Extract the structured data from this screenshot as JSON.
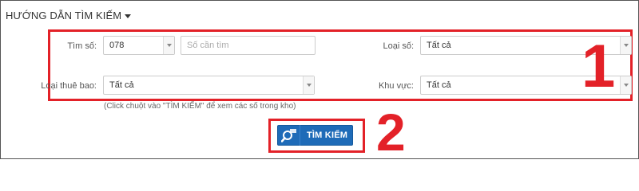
{
  "guide": {
    "title": "HƯỚNG DẪN TÌM KIẾM"
  },
  "form": {
    "find_number": {
      "label": "Tìm số:",
      "prefix_value": "078",
      "number_placeholder": "Số cần tìm"
    },
    "number_type": {
      "label": "Loại số:",
      "value": "Tất cả"
    },
    "subscriber_type": {
      "label": "Loại thuê bao:",
      "value": "Tất cả"
    },
    "region": {
      "label": "Khu vực:",
      "value": "Tất cả"
    },
    "hint": "(Click chuột vào \"TÌM KIẾM\" để xem các số trong kho)"
  },
  "search_button": {
    "label": "TÌM KIẾM"
  },
  "annotations": {
    "step1": "1",
    "step2": "2",
    "accent_color": "#e32128"
  }
}
